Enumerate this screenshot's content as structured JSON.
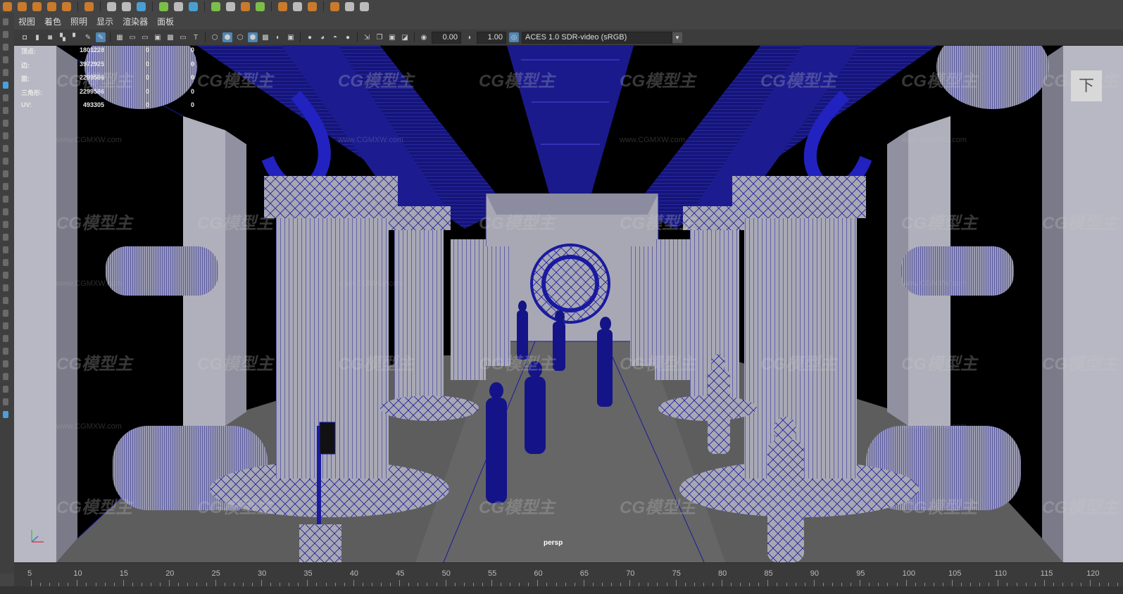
{
  "menubar": {
    "items": [
      "视图",
      "着色",
      "照明",
      "显示",
      "渲染器",
      "面板"
    ]
  },
  "toolbar": {
    "field_a": "0.00",
    "field_b": "1.00",
    "colorspace": "ACES 1.0 SDR-video (sRGB)"
  },
  "hud": {
    "rows": [
      {
        "label": "顶点:",
        "v1": "1801228",
        "v2": "0",
        "v3": "0"
      },
      {
        "label": "边:",
        "v1": "3972925",
        "v2": "0",
        "v3": "0"
      },
      {
        "label": "面:",
        "v1": "2299586",
        "v2": "0",
        "v3": "0"
      },
      {
        "label": "三角形:",
        "v1": "2299586",
        "v2": "0",
        "v3": "0"
      },
      {
        "label": "UV:",
        "v1": "493305",
        "v2": "0",
        "v3": "0"
      }
    ]
  },
  "viewport": {
    "camera_label": "persp",
    "camera_icon": "下",
    "wireframe_color": "#1a1aa0",
    "surface_color": "#a8a8b4"
  },
  "timeline": {
    "ticks": [
      "5",
      "10",
      "15",
      "20",
      "25",
      "30",
      "35",
      "40",
      "45",
      "50",
      "55",
      "60",
      "65",
      "70",
      "75",
      "80",
      "85",
      "90",
      "95",
      "100",
      "105",
      "110",
      "115",
      "120"
    ]
  },
  "watermark": {
    "logo": "CG模型主",
    "url": "www.CGMXW.com"
  }
}
